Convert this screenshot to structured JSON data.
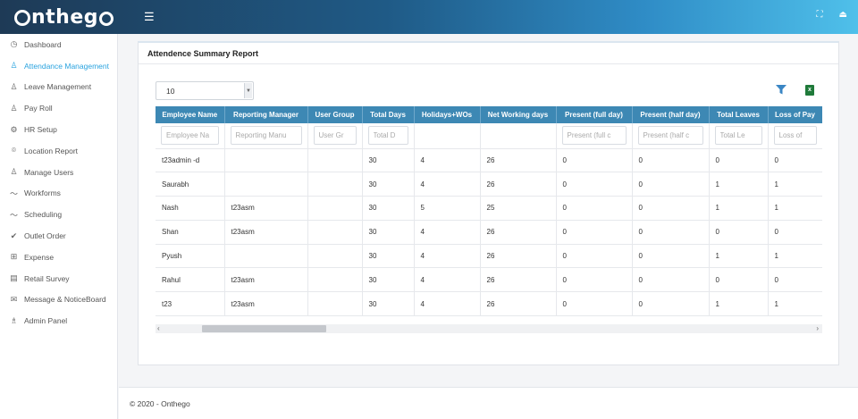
{
  "app": {
    "logo_left": "o",
    "logo_mid": "ntheg",
    "logo_right": "o",
    "menu_icon": "hamburger-icon"
  },
  "topbar": {
    "fullscreen_icon": "expand-icon",
    "logout_icon": "logout-icon"
  },
  "sidebar": {
    "items": [
      {
        "label": "Dashboard",
        "icon": "gauge-icon",
        "glyph": "◷"
      },
      {
        "label": "Attendance Management",
        "icon": "user-icon",
        "glyph": "♙",
        "active": true
      },
      {
        "label": "Leave Management",
        "icon": "user-icon",
        "glyph": "♙"
      },
      {
        "label": "Pay Roll",
        "icon": "user-icon",
        "glyph": "♙"
      },
      {
        "label": "HR Setup",
        "icon": "gear-icon",
        "glyph": "⚙"
      },
      {
        "label": "Location Report",
        "icon": "map-pin-icon",
        "glyph": "⌾"
      },
      {
        "label": "Manage Users",
        "icon": "user-icon",
        "glyph": "♙"
      },
      {
        "label": "Workforms",
        "icon": "trend-icon",
        "glyph": "〜"
      },
      {
        "label": "Scheduling",
        "icon": "trend-icon",
        "glyph": "〜"
      },
      {
        "label": "Outlet Order",
        "icon": "check-icon",
        "glyph": "✔"
      },
      {
        "label": "Expense",
        "icon": "grid-icon",
        "glyph": "⊞"
      },
      {
        "label": "Retail Survey",
        "icon": "document-icon",
        "glyph": "▤"
      },
      {
        "label": "Message & NoticeBoard",
        "icon": "mail-icon",
        "glyph": "✉"
      },
      {
        "label": "Admin Panel",
        "icon": "users-icon",
        "glyph": "♗"
      }
    ]
  },
  "report": {
    "title": "Attendence Summary Report",
    "page_size": "10",
    "excel_label": "x",
    "columns": [
      {
        "label": "Employee Name",
        "placeholder": "Employee Na"
      },
      {
        "label": "Reporting Manager",
        "placeholder": "Reporting Manu"
      },
      {
        "label": "User Group",
        "placeholder": "User Gr"
      },
      {
        "label": "Total Days",
        "placeholder": "Total D"
      },
      {
        "label": "Holidays+WOs",
        "placeholder": ""
      },
      {
        "label": "Net Working days",
        "placeholder": ""
      },
      {
        "label": "Present (full day)",
        "placeholder": "Present (full c"
      },
      {
        "label": "Present (half day)",
        "placeholder": "Present (half c"
      },
      {
        "label": "Total Leaves",
        "placeholder": "Total Le"
      },
      {
        "label": "Loss of Pay",
        "placeholder": "Loss of"
      }
    ],
    "rows": [
      [
        "t23admin -d",
        "",
        "",
        "30",
        "4",
        "26",
        "0",
        "0",
        "0",
        "0"
      ],
      [
        "Saurabh",
        "",
        "",
        "30",
        "4",
        "26",
        "0",
        "0",
        "1",
        "1"
      ],
      [
        "Nash",
        "t23asm",
        "",
        "30",
        "5",
        "25",
        "0",
        "0",
        "1",
        "1"
      ],
      [
        "Shan",
        "t23asm",
        "",
        "30",
        "4",
        "26",
        "0",
        "0",
        "0",
        "0"
      ],
      [
        "Pyush",
        "",
        "",
        "30",
        "4",
        "26",
        "0",
        "0",
        "1",
        "1"
      ],
      [
        "Rahul",
        "t23asm",
        "",
        "30",
        "4",
        "26",
        "0",
        "0",
        "0",
        "0"
      ],
      [
        "t23",
        "t23asm",
        "",
        "30",
        "4",
        "26",
        "0",
        "0",
        "1",
        "1"
      ]
    ],
    "scroll_left": "‹",
    "scroll_right": "›"
  },
  "footer": {
    "text": "© 2020 - Onthego"
  },
  "colors": {
    "header_accent": "#3d88b4",
    "active_nav": "#2aa3df",
    "excel_green": "#1f7a3a",
    "filter_blue": "#3a86c4"
  }
}
